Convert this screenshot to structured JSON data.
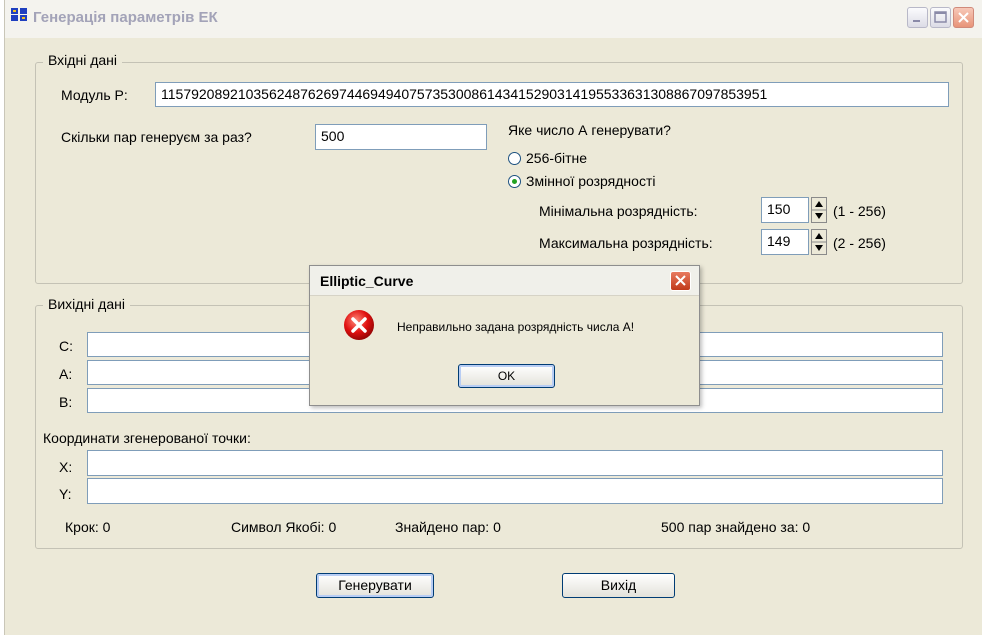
{
  "window": {
    "title": "Генерація параметрів ЕК"
  },
  "input_group": {
    "legend": "Вхідні дані",
    "modulus_label": "Модуль P:",
    "modulus_value": "115792089210356248762697446949407573530086143415290314195533631308867097853951",
    "pairs_label": "Скільки пар генеруєм за раз?",
    "pairs_value": "500",
    "a_question": "Яке число А генерувати?",
    "radio_256": "256-бітне",
    "radio_variable": "Змінної розрядності",
    "selected_radio": "variable",
    "min_label": "Мінімальна розрядність:",
    "min_value": "150",
    "min_range": "(1 - 256)",
    "max_label": "Максимальна розрядність:",
    "max_value": "149",
    "max_range": "(2 - 256)"
  },
  "output_group": {
    "legend": "Вихідні дані",
    "c_label": "C:",
    "a_label": "A:",
    "b_label": "B:",
    "c_value": "",
    "a_value": "",
    "b_value": "",
    "coords_label": "Координати згенерованої точки:",
    "x_label": "X:",
    "y_label": "Y:",
    "x_value": "",
    "y_value": "",
    "step": "Крок: 0",
    "jacobi": "Символ Якобі: 0",
    "found": "Знайдено пар: 0",
    "found_time": "500 пар знайдено за: 0"
  },
  "buttons": {
    "generate": "Генерувати",
    "exit": "Вихід"
  },
  "dialog": {
    "title": "Elliptic_Curve",
    "message": "Неправильно задана розрядність числа А!",
    "ok": "OK",
    "icon": "error-icon"
  },
  "colors": {
    "error_red": "#e01010",
    "radio_dot": "#21a121",
    "field_border": "#7f9db9"
  }
}
